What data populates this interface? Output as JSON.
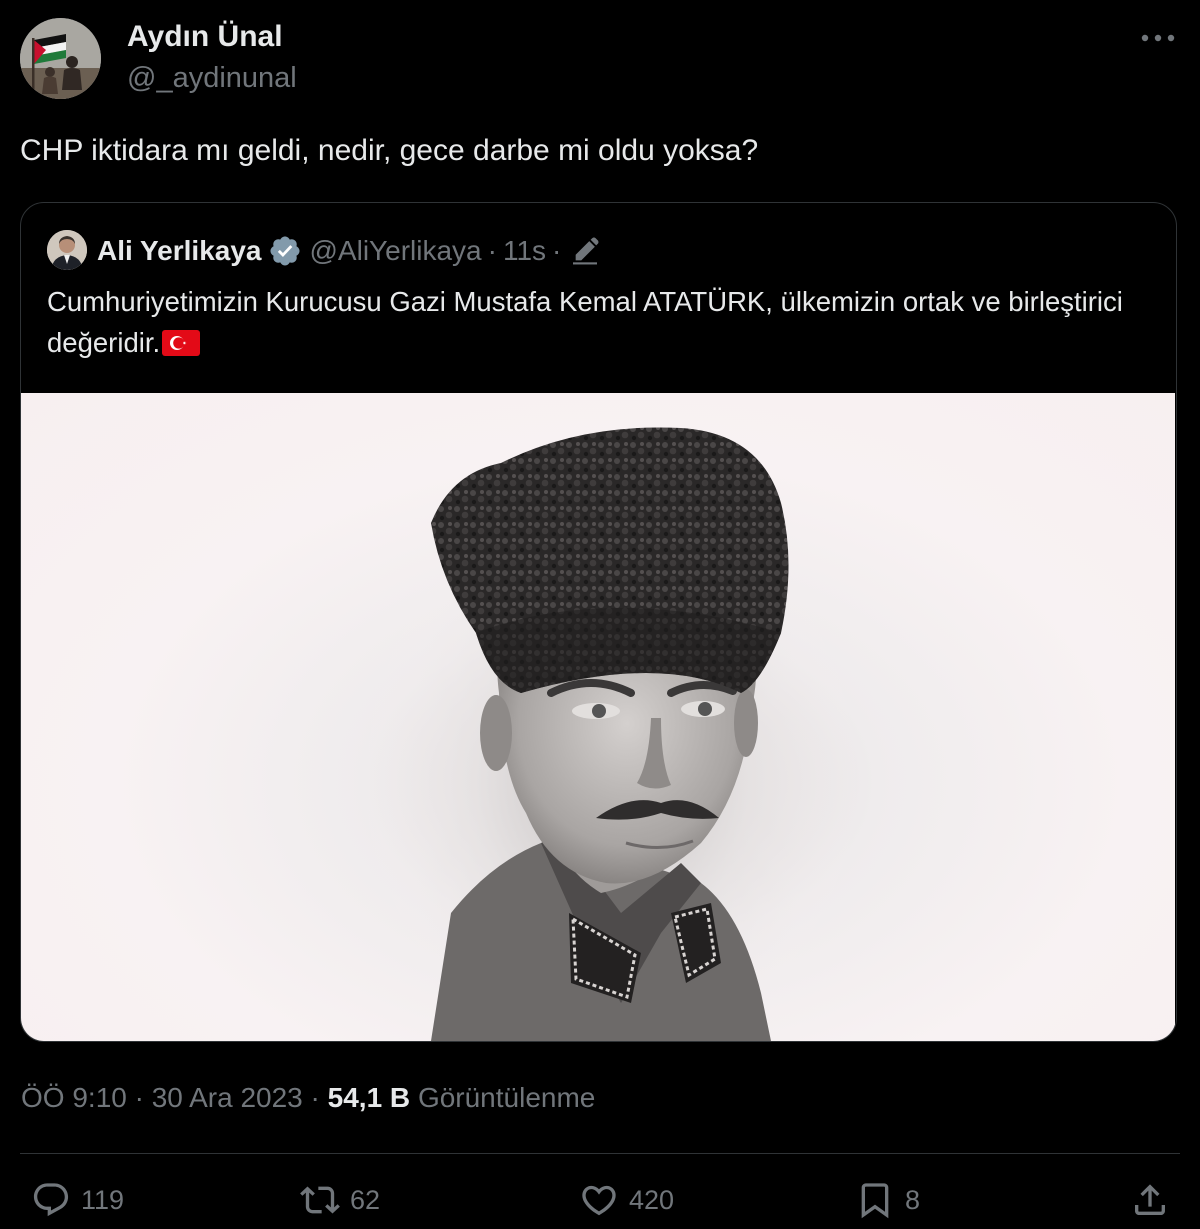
{
  "author": {
    "name": "Aydın Ünal",
    "handle": "@_aydinunal"
  },
  "tweet": {
    "text": "CHP iktidara mı geldi, nedir, gece darbe mi oldu yoksa?"
  },
  "quote": {
    "name": "Ali Yerlikaya",
    "handle": "@AliYerlikaya",
    "sep": "·",
    "time": "11s",
    "text": "Cumhuriyetimizin Kurucusu Gazi Mustafa Kemal ATATÜRK, ülkemizin ortak ve birleştirici değeridir."
  },
  "meta": {
    "time": "ÖÖ 9:10",
    "sep1": "·",
    "date": "30 Ara 2023",
    "sep2": "·",
    "views_count": "54,1 B",
    "views_label": "Görüntülenme"
  },
  "actions": {
    "replies": "119",
    "retweets": "62",
    "likes": "420",
    "bookmarks": "8"
  },
  "colors": {
    "background": "#000000",
    "text": "#e7e9ea",
    "muted": "#71767b",
    "verified": "#829aab",
    "flag": "#e30a17"
  },
  "icons": {
    "more": "more-icon",
    "verified": "verified-badge-icon",
    "edit": "edit-icon",
    "flag": "turkey-flag-emoji",
    "reply": "reply-icon",
    "retweet": "retweet-icon",
    "like": "like-icon",
    "bookmark": "bookmark-icon",
    "share": "share-icon"
  }
}
